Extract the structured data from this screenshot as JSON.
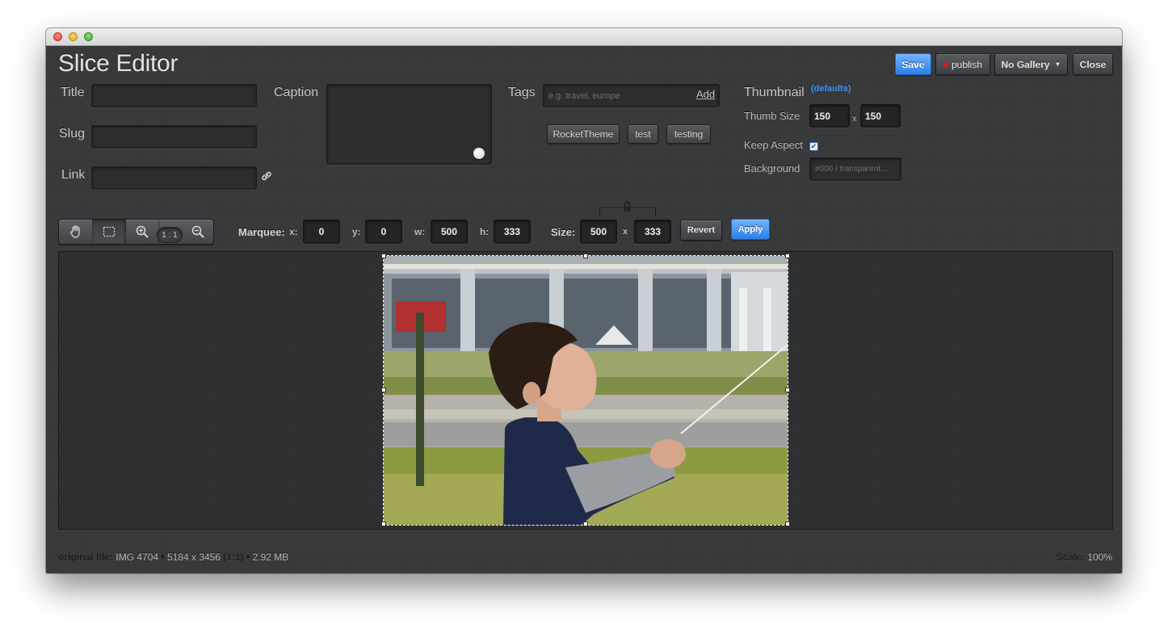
{
  "app_title": "Slice Editor",
  "form": {
    "title_label": "Title",
    "slug_label": "Slug",
    "link_label": "Link",
    "caption_label": "Caption",
    "title_value": "",
    "slug_value": "",
    "link_value": "",
    "caption_value": ""
  },
  "tags": {
    "label": "Tags",
    "placeholder": "e.g. travel, europe",
    "add_label": "Add",
    "items": [
      "RocketTheme",
      "test",
      "testing"
    ]
  },
  "thumbnail": {
    "label": "Thumbnail",
    "defaults_link": "(defaults)",
    "thumb_size_label": "Thumb Size",
    "width": "150",
    "separator": "x",
    "height": "150",
    "keep_aspect_label": "Keep Aspect",
    "keep_aspect_checked": true,
    "background_label": "Background",
    "background_placeholder": "#000 / transparent..."
  },
  "header_buttons": {
    "save": "Save",
    "publish": "publish",
    "publish_dot_color": "#e01818",
    "gallery": "No Gallery",
    "gallery_caret": "▼",
    "close": "Close"
  },
  "toolbar": {
    "tools": [
      "hand-icon",
      "marquee-select-icon",
      "zoom-in-icon",
      "zoom-out-icon"
    ],
    "ratio": "1 : 1",
    "marquee_label": "Marquee:",
    "x_label": "x:",
    "x_value": "0",
    "y_label": "y:",
    "y_value": "0",
    "w_label": "w:",
    "w_value": "500",
    "h_label": "h:",
    "h_value": "333",
    "size_label": "Size:",
    "size_width": "500",
    "size_separator": "x",
    "size_height": "333",
    "revert": "Revert",
    "apply": "Apply"
  },
  "footer": {
    "original_file_label": "original file:",
    "file_name": "IMG 4704",
    "dimensions": "5184 x 3456",
    "ratio": "(1:1)",
    "file_size": "2.92 MB",
    "bullet": "•",
    "scale_label": "Scale:",
    "scale_value": "100%"
  },
  "colors": {
    "accent_blue": "#3b8cf0",
    "window_bg": "#38393b"
  }
}
